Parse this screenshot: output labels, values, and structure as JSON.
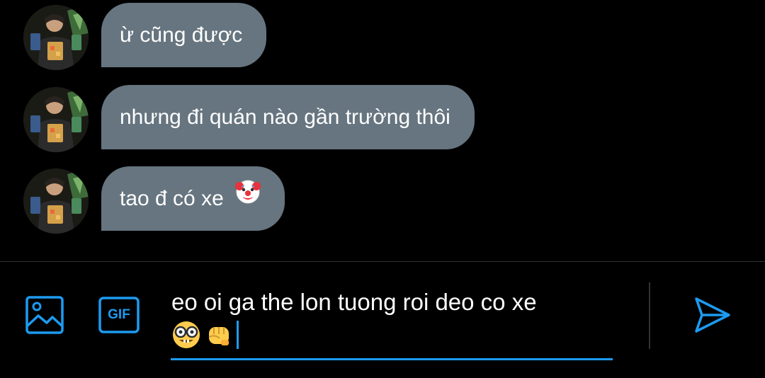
{
  "messages": [
    {
      "text": "ừ cũng được",
      "emoji": ""
    },
    {
      "text": "nhưng đi quán nào gần trường thôi",
      "emoji": ""
    },
    {
      "text": "tao đ có xe",
      "emoji": "clown-face"
    }
  ],
  "composer": {
    "line1": "eo oi ga the lon tuong roi deo co xe",
    "line2_emojis": [
      "nerd-face",
      "oncoming-fist"
    ],
    "image_button_icon": "image-icon",
    "gif_label": "GIF",
    "send_icon": "send-icon"
  },
  "colors": {
    "background": "#000000",
    "bubble": "#66757f",
    "accent": "#1d9bf0",
    "divider": "#2f3336"
  }
}
